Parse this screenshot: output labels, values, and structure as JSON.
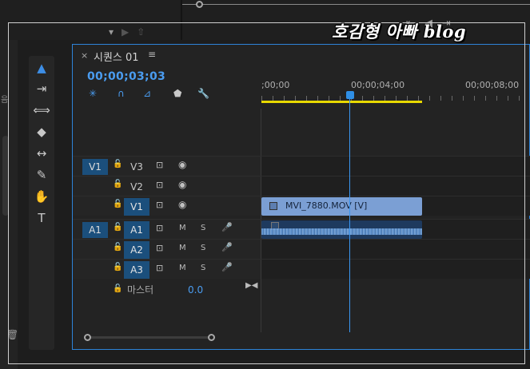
{
  "left_panel": {
    "label": "음"
  },
  "top_icons": [
    "▾",
    "▶",
    "⇧"
  ],
  "right_top_icons": [
    "⇤",
    "◀",
    "⇥"
  ],
  "tools": [
    {
      "icon": "selection-icon",
      "glyph": "▲",
      "active": true
    },
    {
      "icon": "track-select-icon",
      "glyph": "⇥"
    },
    {
      "icon": "ripple-edit-icon",
      "glyph": "⟺"
    },
    {
      "icon": "razor-icon",
      "glyph": "◆"
    },
    {
      "icon": "slip-icon",
      "glyph": "↔"
    },
    {
      "icon": "pen-icon",
      "glyph": "✎"
    },
    {
      "icon": "hand-icon",
      "glyph": "✋"
    },
    {
      "icon": "type-icon",
      "glyph": "T"
    }
  ],
  "timeline": {
    "close": "×",
    "title": "시퀀스 01",
    "menu": "≡",
    "timecode": "00;00;03;03",
    "ruler_labels": [
      ";00;00",
      "00;00;04;00",
      "00;00;08;00"
    ],
    "controls": {
      "snap": "✳",
      "magnet": "∩",
      "link": "⊿",
      "marker": "⬟",
      "wrench": "🔧"
    }
  },
  "video_tracks": [
    {
      "src": "V1",
      "name": "V3",
      "lock": "🔓",
      "film": "⊡",
      "eye": "◉",
      "target": false,
      "show_src": true
    },
    {
      "src": "",
      "name": "V2",
      "lock": "🔓",
      "film": "⊡",
      "eye": "◉",
      "target": false,
      "show_src": false
    },
    {
      "src": "",
      "name": "V1",
      "lock": "🔓",
      "film": "⊡",
      "eye": "◉",
      "target": true,
      "show_src": false
    }
  ],
  "audio_tracks": [
    {
      "src": "A1",
      "name": "A1",
      "lock": "🔓",
      "film": "⊡",
      "m": "M",
      "s": "S",
      "mic": "🎤"
    },
    {
      "src": "",
      "name": "A2",
      "lock": "🔓",
      "film": "⊡",
      "m": "M",
      "s": "S",
      "mic": "🎤"
    },
    {
      "src": "",
      "name": "A3",
      "lock": "🔓",
      "film": "⊡",
      "m": "M",
      "s": "S",
      "mic": "🎤"
    }
  ],
  "clip": {
    "name": "MVI_7880.MOV [V]"
  },
  "master": {
    "lock": "🔓",
    "label": "마스터",
    "value": "0.0",
    "end": "▶◀"
  },
  "watermark": "호감형 아빠 blog",
  "colors": {
    "accent": "#2d83d8",
    "timecode": "#4a9cf0",
    "work_area": "#e8d800",
    "track_target": "#1b4f7c",
    "video_clip": "#7b9fd4"
  },
  "trash_icon": "🗑"
}
